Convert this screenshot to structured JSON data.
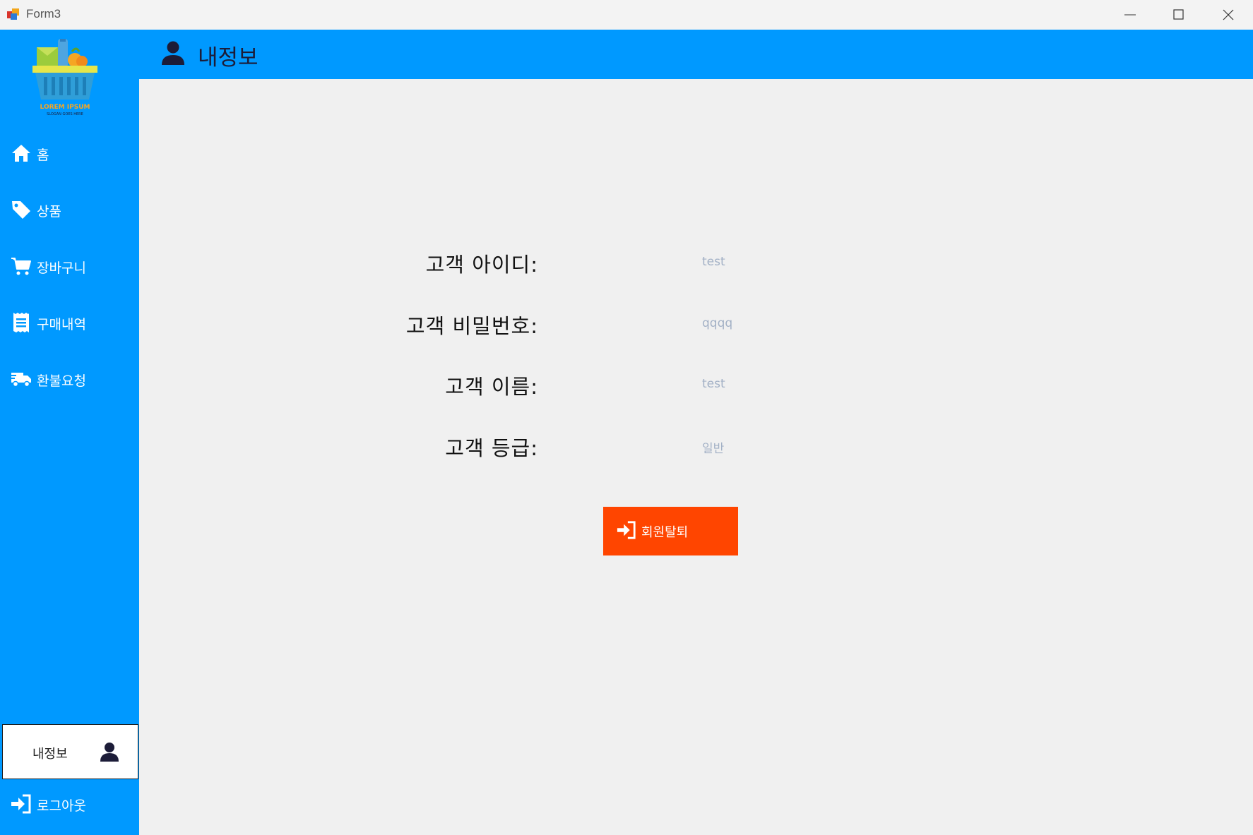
{
  "window": {
    "title": "Form3"
  },
  "sidebar": {
    "logo_text": "LOREM IPSUM",
    "logo_slogan": "SLOGAN GOES HERE",
    "items": [
      {
        "label": "홈",
        "icon": "home-icon"
      },
      {
        "label": "상품",
        "icon": "tag-icon"
      },
      {
        "label": "장바구니",
        "icon": "cart-icon"
      },
      {
        "label": "구매내역",
        "icon": "receipt-icon"
      },
      {
        "label": "환불요청",
        "icon": "truck-icon"
      }
    ],
    "profile": {
      "label": "내정보",
      "icon": "user-icon"
    },
    "logout": {
      "label": "로그아웃",
      "icon": "sign-in-icon"
    }
  },
  "header": {
    "title": "내정보",
    "icon": "user-icon"
  },
  "fields": [
    {
      "label": "고객 아이디:",
      "value": "test"
    },
    {
      "label": "고객 비밀번호:",
      "value": "qqqq"
    },
    {
      "label": "고객 이름:",
      "value": "test"
    },
    {
      "label": "고객 등급:",
      "value": "일반"
    }
  ],
  "withdraw_button": {
    "label": "회원탈퇴",
    "icon": "sign-in-icon"
  },
  "colors": {
    "sidebar": "#0099ff",
    "header": "#0099ff",
    "button": "#ff4500",
    "value_text": "#a3b1c6",
    "dark_icon": "#1c1c38"
  }
}
